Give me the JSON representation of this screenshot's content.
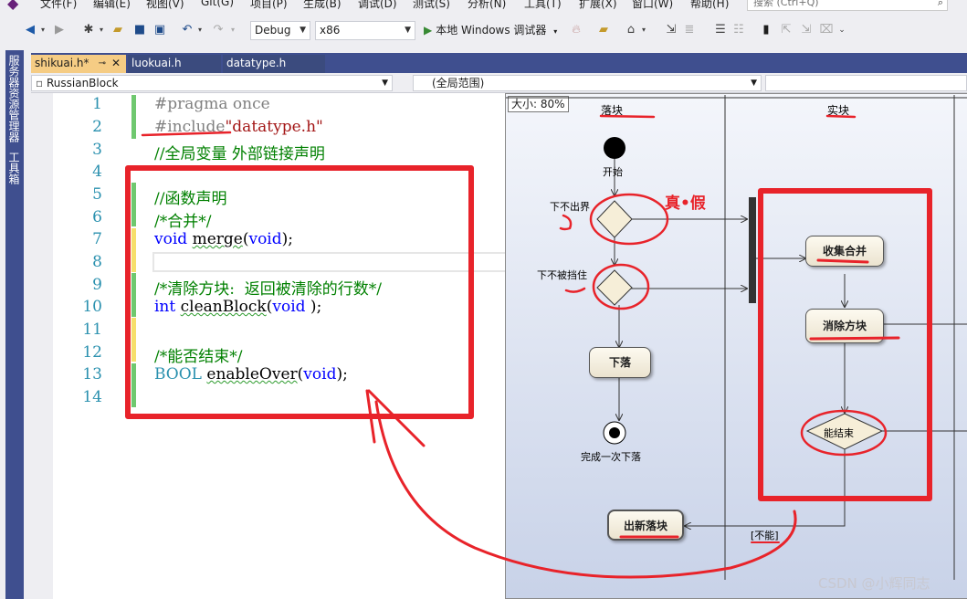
{
  "menu": {
    "items": [
      "文件(F)",
      "编辑(E)",
      "视图(V)",
      "Git(G)",
      "项目(P)",
      "生成(B)",
      "调试(D)",
      "测试(S)",
      "分析(N)",
      "工具(T)",
      "扩展(X)",
      "窗口(W)",
      "帮助(H)"
    ],
    "search_placeholder": "搜索 (Ctrl+Q)"
  },
  "toolbar": {
    "configuration": "Debug",
    "platform": "x86",
    "run_label": "本地 Windows 调试器"
  },
  "side_windows": [
    "服务器资源管理器",
    "工具箱"
  ],
  "tabs": [
    {
      "label": "shikuai.h*",
      "active": true
    },
    {
      "label": "luokuai.h",
      "active": false
    },
    {
      "label": "datatype.h",
      "active": false
    }
  ],
  "navbar": {
    "project": "RussianBlock",
    "scope": "(全局范围)"
  },
  "editor": {
    "line_numbers": [
      "1",
      "2",
      "3",
      "4",
      "5",
      "6",
      "7",
      "8",
      "9",
      "10",
      "11",
      "12",
      "13",
      "14"
    ],
    "lines": {
      "l1": "#pragma once",
      "l2_directive": "#include",
      "l2_file": "\"datatype.h\"",
      "l3": "//全局变量 外部链接声明",
      "l5": "//函数声明",
      "l6": "/*合并*/",
      "l7_type": "void",
      "l7_name": "merge",
      "l7_param": "void",
      "l9": "/*清除方块:  返回被清除的行数*/",
      "l10_type": "int",
      "l10_name": "cleanBlock",
      "l10_param": "void",
      "l12": "/*能否结束*/",
      "l13_type": "BOOL",
      "l13_name": "enableOver",
      "l13_param": "void"
    }
  },
  "diagram": {
    "zoom": "大小: 80%",
    "lanes": [
      "落块",
      "实块"
    ],
    "start_label": "开始",
    "decision1_label": "下不出界",
    "decision2_label": "下不被挡住",
    "node_fall": "下落",
    "end_label": "完成一次下落",
    "node_new": "出新落块",
    "node_merge": "收集合并",
    "node_clear": "消除方块",
    "decision_end": "能结束",
    "guard_cannot": "[不能]"
  },
  "annotation": {
    "true_false": "真•假",
    "colors": {
      "ink": "#e8232a"
    }
  },
  "watermark": "CSDN @小辉同志"
}
